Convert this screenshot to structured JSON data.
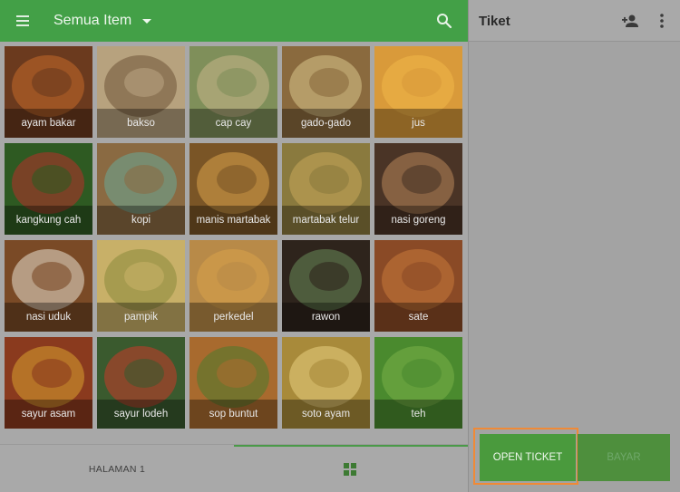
{
  "appbar": {
    "title": "Semua Item",
    "icons": {
      "menu": "menu-icon",
      "dropdown": "caret-down-icon",
      "search": "search-icon"
    }
  },
  "items": [
    {
      "label": "ayam bakar",
      "color": "#6b3a1e",
      "accent": "#c46a2a"
    },
    {
      "label": "bakso",
      "color": "#b7a27e",
      "accent": "#6f5436"
    },
    {
      "label": "cap cay",
      "color": "#7f8f5a",
      "accent": "#c9b68a"
    },
    {
      "label": "gado-gado",
      "color": "#8a6a3e",
      "accent": "#d8c48a"
    },
    {
      "label": "jus",
      "color": "#d99a3a",
      "accent": "#f0b848"
    },
    {
      "label": "kangkung cah",
      "color": "#2e5a22",
      "accent": "#b8302a"
    },
    {
      "label": "kopi",
      "color": "#8a6a42",
      "accent": "#6aa898"
    },
    {
      "label": "manis martabak",
      "color": "#7a5526",
      "accent": "#d9a24a"
    },
    {
      "label": "martabak telur",
      "color": "#8a7a3e",
      "accent": "#c8a85a"
    },
    {
      "label": "nasi goreng",
      "color": "#4a3426",
      "accent": "#b8865a"
    },
    {
      "label": "nasi uduk",
      "color": "#7a4a26",
      "accent": "#e8e0d0"
    },
    {
      "label": "pampik",
      "color": "#c8b068",
      "accent": "#8a8a3a"
    },
    {
      "label": "perkedel",
      "color": "#b88a48",
      "accent": "#d8a24a"
    },
    {
      "label": "rawon",
      "color": "#2e241c",
      "accent": "#6a8a5a"
    },
    {
      "label": "sate",
      "color": "#8a4a26",
      "accent": "#c87a3a"
    },
    {
      "label": "sayur asam",
      "color": "#8a3a1e",
      "accent": "#d8a030"
    },
    {
      "label": "sayur lodeh",
      "color": "#3a5a2e",
      "accent": "#c83a2a"
    },
    {
      "label": "sop buntut",
      "color": "#a86a2e",
      "accent": "#4a7a2e"
    },
    {
      "label": "soto ayam",
      "color": "#a88a3a",
      "accent": "#e8d080"
    },
    {
      "label": "teh",
      "color": "#4a8a2e",
      "accent": "#7ab048"
    }
  ],
  "bottom": {
    "page_label": "HALAMAN 1",
    "grid_icon": "grid-view-icon"
  },
  "ticket": {
    "title": "Tiket",
    "icons": {
      "add_customer": "add-person-icon",
      "more": "more-vert-icon"
    },
    "open_label": "OPEN TICKET",
    "pay_label": "BAYAR"
  },
  "colors": {
    "primary": "#43a047",
    "highlight": "#f08a36"
  }
}
